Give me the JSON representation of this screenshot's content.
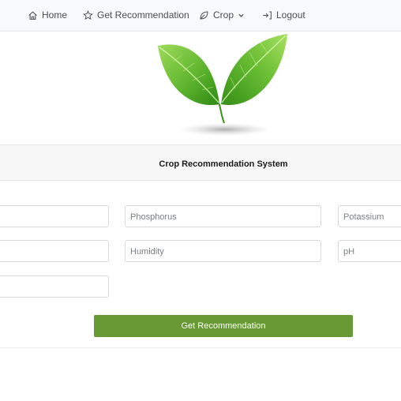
{
  "nav": {
    "home_label": "Home",
    "recommend_label": "Get Recommendation",
    "crop_label": "Crop",
    "logout_label": "Logout",
    "icons": {
      "home": "home-icon",
      "recommend": "star-icon",
      "crop": "leaf-icon",
      "logout": "logout-icon",
      "dropdown": "chevron-down-icon"
    }
  },
  "logo": {
    "name": "green-leaves-logo",
    "colors": {
      "leaf_light": "#8fd14f",
      "leaf_dark": "#3f9a1a"
    }
  },
  "title": "Crop Recommendation System",
  "form": {
    "phosphorus_placeholder": "Phosphorus",
    "potassium_placeholder": "Potassium",
    "humidity_placeholder": "Humidity",
    "ph_placeholder": "pH",
    "submit_label": "Get Recommendation"
  },
  "colors": {
    "button": "#679a35",
    "navbar": "#f8f9fa",
    "title_bar": "#f7f7f7"
  }
}
